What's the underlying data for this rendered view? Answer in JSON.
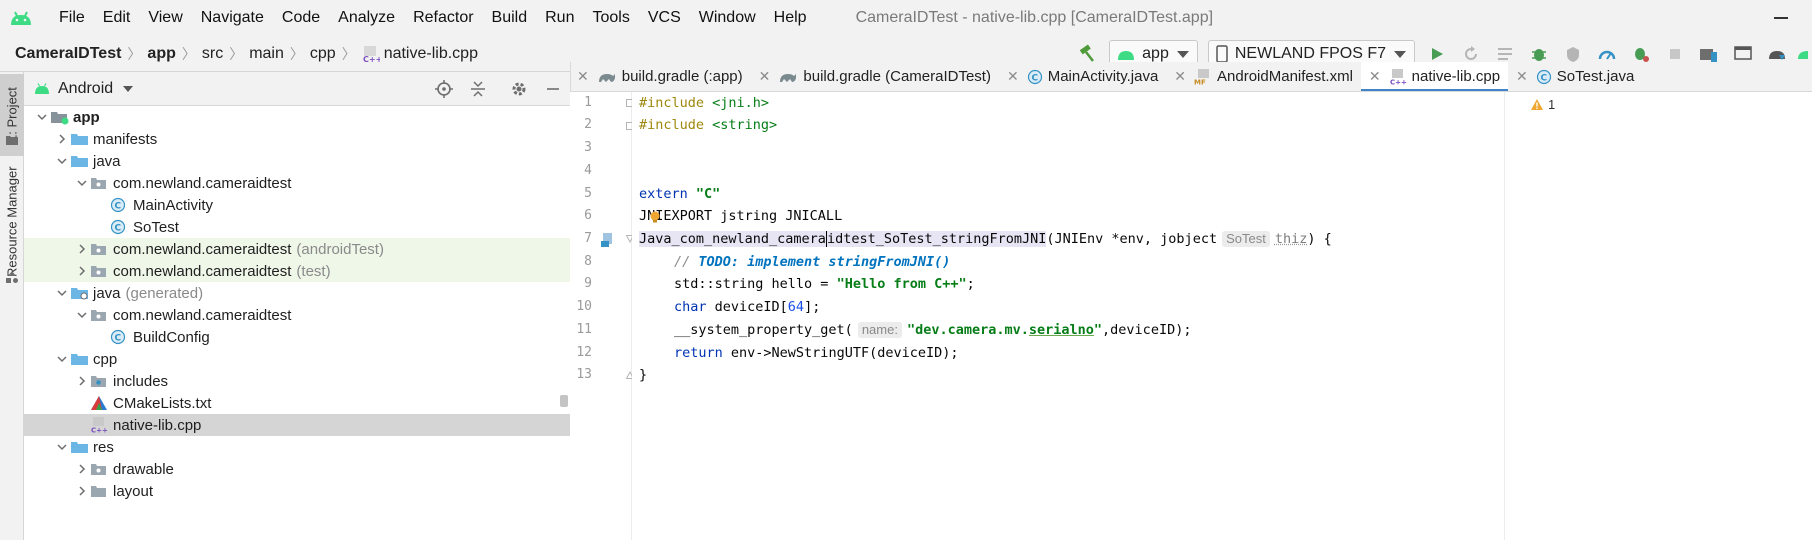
{
  "window": {
    "title": "CameraIDTest - native-lib.cpp [CameraIDTest.app]",
    "menu": [
      {
        "label": "File",
        "mnemonic": "F"
      },
      {
        "label": "Edit",
        "mnemonic": "E"
      },
      {
        "label": "View",
        "mnemonic": "V"
      },
      {
        "label": "Navigate",
        "mnemonic": "N"
      },
      {
        "label": "Code",
        "mnemonic": "C"
      },
      {
        "label": "Analyze",
        "mnemonic": "z"
      },
      {
        "label": "Refactor",
        "mnemonic": "R"
      },
      {
        "label": "Build",
        "mnemonic": "B"
      },
      {
        "label": "Run",
        "mnemonic": "u"
      },
      {
        "label": "Tools",
        "mnemonic": "T"
      },
      {
        "label": "VCS",
        "mnemonic": "S"
      },
      {
        "label": "Window",
        "mnemonic": "W"
      },
      {
        "label": "Help",
        "mnemonic": "H"
      }
    ]
  },
  "breadcrumb": [
    "CameraIDTest",
    "app",
    "src",
    "main",
    "cpp",
    "native-lib.cpp"
  ],
  "toolbar": {
    "run_config": "app",
    "device": "NEWLAND FPOS F7"
  },
  "toolstrip": {
    "project_tab": "1: Project",
    "resource_tab": "Resource Manager"
  },
  "project_panel": {
    "view_mode": "Android",
    "tree": [
      {
        "label": "app",
        "bold": true
      },
      {
        "label": "manifests"
      },
      {
        "label": "java"
      },
      {
        "label": "com.newland.cameraidtest"
      },
      {
        "label": "MainActivity"
      },
      {
        "label": "SoTest"
      },
      {
        "label": "com.newland.cameraidtest",
        "suffix": "(androidTest)"
      },
      {
        "label": "com.newland.cameraidtest",
        "suffix": "(test)"
      },
      {
        "label": "java",
        "suffix": "(generated)"
      },
      {
        "label": "com.newland.cameraidtest"
      },
      {
        "label": "BuildConfig"
      },
      {
        "label": "cpp"
      },
      {
        "label": "includes"
      },
      {
        "label": "CMakeLists.txt"
      },
      {
        "label": "native-lib.cpp"
      },
      {
        "label": "res"
      },
      {
        "label": "drawable"
      },
      {
        "label": "layout"
      }
    ]
  },
  "editor": {
    "tabs": [
      {
        "label": "build.gradle (:app)"
      },
      {
        "label": "build.gradle (CameraIDTest)"
      },
      {
        "label": "MainActivity.java"
      },
      {
        "label": "AndroidManifest.xml"
      },
      {
        "label": "native-lib.cpp",
        "active": true
      },
      {
        "label": "SoTest.java"
      }
    ],
    "line_numbers": [
      "1",
      "2",
      "3",
      "4",
      "5",
      "6",
      "7",
      "8",
      "9",
      "10",
      "11",
      "12",
      "13"
    ],
    "code": {
      "l1_directive": "#include ",
      "l1_header": "<jni.h>",
      "l2_directive": "#include ",
      "l2_header": "<string>",
      "l5_kw": "extern ",
      "l5_str": "\"C\"",
      "l6": "JNIEXPORT jstring JNICALL",
      "l7_fn_a": "Java_com_newland_camera",
      "l7_fn_b": "idtest_SoTest_stringFromJNI",
      "l7_args": "(JNIEnv *env, jobject",
      "l7_hint": "SoTest",
      "l7_param": "thiz",
      "l7_end": ") {",
      "l8_comment": "// ",
      "l8_todo": "TODO: implement stringFromJNI()",
      "l9_type": "std::string hello = ",
      "l9_str": "\"Hello from C++\"",
      "l9_end": ";",
      "l10_kw": "char ",
      "l10_var": "deviceID[",
      "l10_num": "64",
      "l10_end": "];",
      "l11_fn": "__system_property_get(",
      "l11_hint": "name:",
      "l11_str_a": "\"dev.camera.mv.",
      "l11_str_b": "serialno",
      "l11_str_c": "\"",
      "l11_end": ",deviceID);",
      "l12_kw": "return ",
      "l12_rest": "env->NewStringUTF(deviceID);",
      "l13": "}"
    },
    "warnings": "1"
  }
}
